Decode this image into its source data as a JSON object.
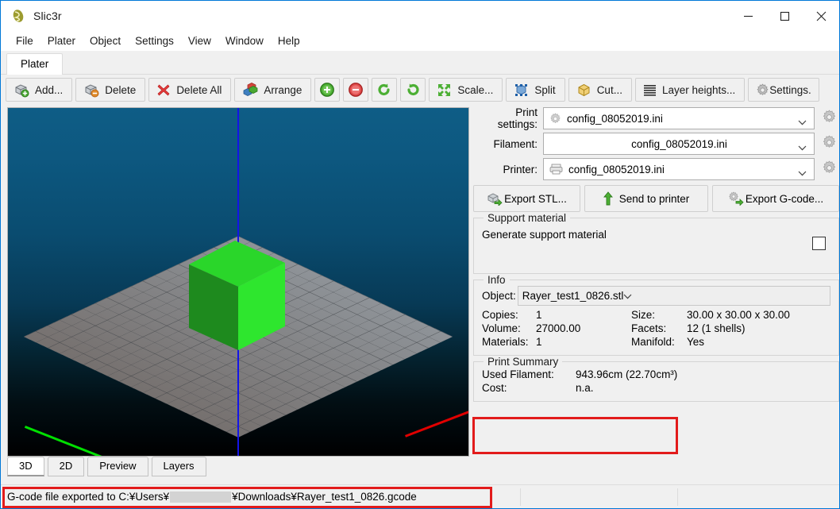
{
  "window": {
    "title": "Slic3r",
    "logo_icon": "slic3r-logo-icon",
    "minimize_icon": "minimize-icon",
    "maximize_icon": "maximize-icon",
    "close_icon": "close-icon",
    "accent_color": "#0078d7"
  },
  "menubar": {
    "items": [
      {
        "label": "File"
      },
      {
        "label": "Plater"
      },
      {
        "label": "Object"
      },
      {
        "label": "Settings"
      },
      {
        "label": "View"
      },
      {
        "label": "Window"
      },
      {
        "label": "Help"
      }
    ]
  },
  "tabs": {
    "active": "Plater",
    "items": [
      {
        "label": "Plater"
      }
    ]
  },
  "toolbar": {
    "buttons": [
      {
        "label": "Add...",
        "icon": "add-object-icon"
      },
      {
        "label": "Delete",
        "icon": "delete-object-icon"
      },
      {
        "label": "Delete All",
        "icon": "delete-all-icon"
      },
      {
        "label": "Arrange",
        "icon": "arrange-icon"
      },
      {
        "label": "",
        "icon": "increase-copies-icon"
      },
      {
        "label": "",
        "icon": "decrease-copies-icon"
      },
      {
        "label": "",
        "icon": "rotate-ccw-icon"
      },
      {
        "label": "",
        "icon": "rotate-cw-icon"
      },
      {
        "label": "Scale...",
        "icon": "scale-icon"
      },
      {
        "label": "Split",
        "icon": "split-icon"
      },
      {
        "label": "Cut...",
        "icon": "cut-icon"
      },
      {
        "label": "Layer heights...",
        "icon": "layer-heights-icon"
      },
      {
        "label": "Settings.",
        "icon": "settings-gear-icon"
      }
    ]
  },
  "viewport": {
    "tabs": [
      {
        "label": "3D",
        "active": true
      },
      {
        "label": "2D",
        "active": false
      },
      {
        "label": "Preview",
        "active": false
      },
      {
        "label": "Layers",
        "active": false
      }
    ],
    "object_color": "#22cc22",
    "axis_x_color": "#e00000",
    "axis_y_color": "#00e000",
    "axis_z_color": "#1414e6",
    "bed_color": "#6f7277",
    "background_top": "#0e5d86",
    "background_bottom": "#000000"
  },
  "presets": {
    "rows": [
      {
        "label": "Print settings:",
        "value": "config_08052019.ini",
        "icon": "print-settings-icon",
        "gear": "gear-icon",
        "centered": false
      },
      {
        "label": "Filament:",
        "value": "config_08052019.ini",
        "icon": "",
        "gear": "gear-icon",
        "centered": true
      },
      {
        "label": "Printer:",
        "value": "config_08052019.ini",
        "icon": "printer-icon",
        "gear": "gear-icon",
        "centered": false
      }
    ]
  },
  "actions": {
    "export_stl": {
      "label": "Export STL...",
      "icon": "export-stl-icon"
    },
    "send_to_printer": {
      "label": "Send to printer",
      "icon": "upload-arrow-icon"
    },
    "export_gcode": {
      "label": "Export G-code...",
      "icon": "export-gcode-icon"
    }
  },
  "support_material": {
    "legend": "Support material",
    "generate_label": "Generate support material",
    "generate_checked": false,
    "checkbox_icon": "checkbox-unchecked-icon"
  },
  "info": {
    "legend": "Info",
    "object_label": "Object:",
    "object_value": "Rayer_test1_0826.stl",
    "rows": [
      {
        "k1": "Copies:",
        "v1": "1",
        "k2": "Size:",
        "v2": "30.00 x 30.00 x 30.00"
      },
      {
        "k1": "Volume:",
        "v1": "27000.00",
        "k2": "Facets:",
        "v2": "12 (1 shells)"
      },
      {
        "k1": "Materials:",
        "v1": "1",
        "k2": "Manifold:",
        "v2": "Yes"
      }
    ]
  },
  "print_summary": {
    "legend": "Print Summary",
    "rows": [
      {
        "k": "Used Filament:",
        "v": "943.96cm (22.70cm³)"
      },
      {
        "k": "Cost:",
        "v": "n.a."
      }
    ]
  },
  "status": {
    "message_prefix": "G-code file exported to C:¥Users¥",
    "message_suffix": "¥Downloads¥Rayer_test1_0826.gcode",
    "redacted": true
  },
  "annotations": {
    "highlight_color": "#e21b1b",
    "boxes": [
      {
        "name": "print-summary-highlight"
      },
      {
        "name": "status-message-highlight"
      }
    ]
  }
}
